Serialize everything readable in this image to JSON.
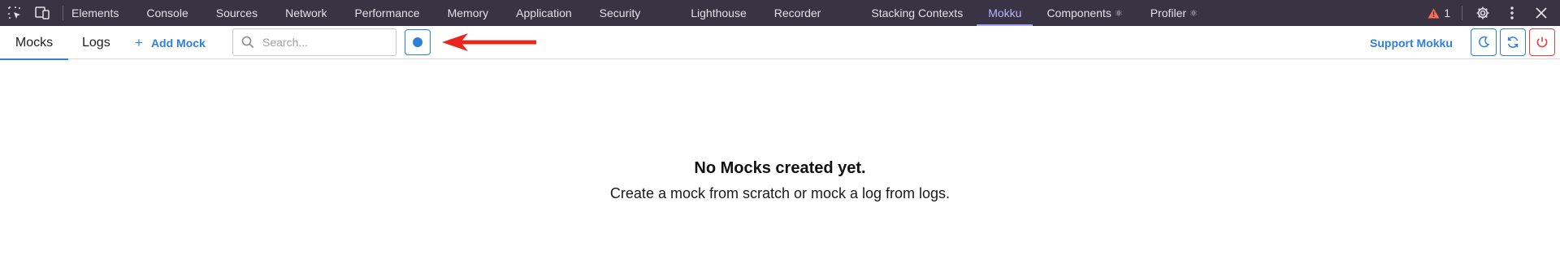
{
  "devtools": {
    "tabs": [
      {
        "label": "Elements"
      },
      {
        "label": "Console"
      },
      {
        "label": "Sources"
      },
      {
        "label": "Network"
      },
      {
        "label": "Performance"
      },
      {
        "label": "Memory"
      },
      {
        "label": "Application"
      },
      {
        "label": "Security"
      },
      {
        "label": "Lighthouse"
      },
      {
        "label": "Recorder"
      },
      {
        "label": "Stacking Contexts"
      },
      {
        "label": "Mokku"
      },
      {
        "label": "Components"
      },
      {
        "label": "Profiler"
      }
    ],
    "active_tab": "Mokku",
    "warning_count": "1"
  },
  "mokku": {
    "tabs": {
      "mocks": "Mocks",
      "logs": "Logs"
    },
    "add_mock_label": "Add Mock",
    "search_placeholder": "Search...",
    "support_label": "Support Mokku"
  },
  "empty_state": {
    "title": "No Mocks created yet.",
    "subtitle": "Create a mock from scratch or mock a log from logs."
  },
  "colors": {
    "devtools_bg": "#3a3344",
    "accent": "#2f80d8",
    "danger": "#e04444",
    "annotation_arrow": "#e8261d"
  }
}
